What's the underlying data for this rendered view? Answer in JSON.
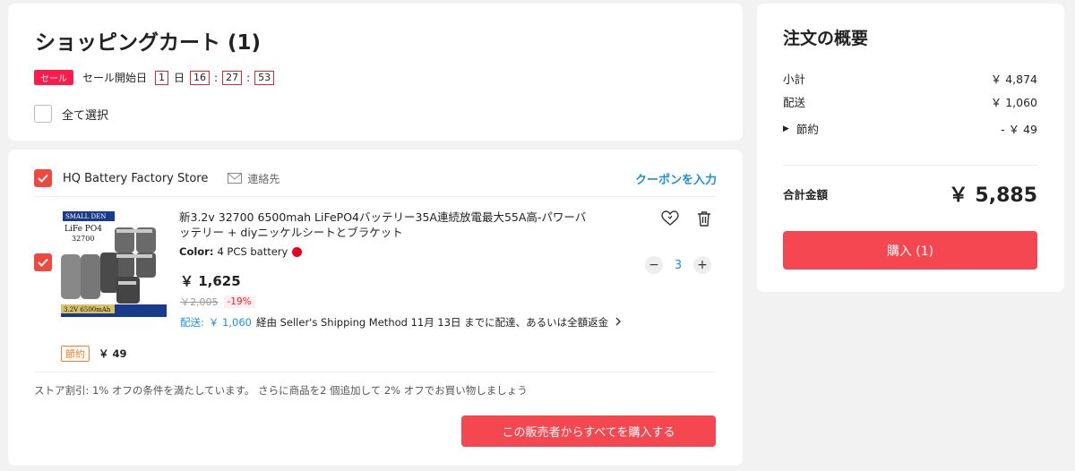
{
  "cart": {
    "title": "ショッピングカート (1)",
    "sale": {
      "badge": "セール",
      "text": "セール開始日",
      "days": "1",
      "day_unit": "日",
      "hours": "16",
      "minutes": "27",
      "seconds": "53",
      "separator": ":"
    },
    "select_all_label": "全て選択",
    "select_all_checked": false
  },
  "store": {
    "name": "HQ Battery Factory Store",
    "contact_label": "連絡先",
    "coupon_label": "クーポンを入力",
    "checked": true,
    "item": {
      "checked": true,
      "image_label_top": "SMALL DEN",
      "image_label_chem": "LiFe PO4",
      "image_label_model": "32700",
      "image_label_bottom": "3.2V 6500mAh",
      "title": "新3.2v 32700 6500mah LiFePO4バッテリー35A連続放電最大55A高-パワーバッテリー + diyニッケルシートとブラケット",
      "color_label": "Color:",
      "color_value": "4 PCS battery",
      "color_hex": "#e8001c",
      "price": "￥ 1,625",
      "original_price": "￥2,005",
      "discount": "-19%",
      "shipping_label": "配送:",
      "shipping_price": "￥ 1,060",
      "shipping_desc": "経由 Seller's Shipping Method 11月 13日 までに配達、あるいは全額返金",
      "quantity": "3",
      "minus": "−",
      "plus": "+"
    },
    "saving_badge": "節約",
    "saving_amount": "￥ 49",
    "store_discount_text": "ストア割引: 1% オフの条件を満たしています。 さらに商品を2 個追加して 2% オフでお買い物しましょう",
    "buy_all_label": "この販売者からすべてを購入する"
  },
  "summary": {
    "title": "注文の概要",
    "subtotal_label": "小計",
    "subtotal_value": "￥ 4,874",
    "shipping_label": "配送",
    "shipping_value": "￥ 1,060",
    "savings_label": "節約",
    "savings_value": "- ￥ 49",
    "total_label": "合計金額",
    "total_value": "￥ 5,885",
    "buy_label": "購入 (1)"
  },
  "colors": {
    "accent_red": "#f5474f",
    "link_blue": "#1f8fd8",
    "sale_pink": "#ff1a4d",
    "saving_orange": "#ff7a1a"
  }
}
